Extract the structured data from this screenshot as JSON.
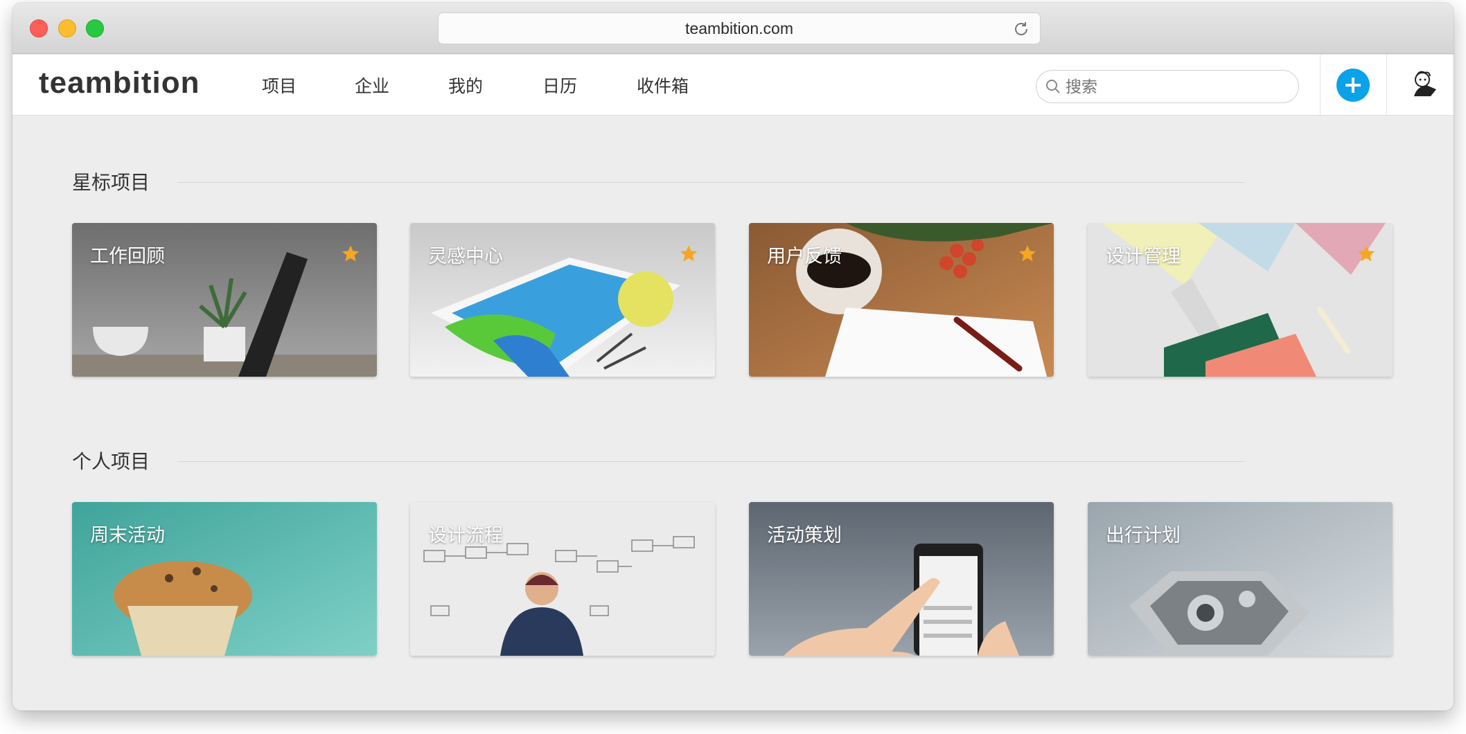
{
  "browser": {
    "url": "teambition.com"
  },
  "header": {
    "logo": "teambition",
    "nav": [
      "项目",
      "企业",
      "我的",
      "日历",
      "收件箱"
    ],
    "search_placeholder": "搜索"
  },
  "sections": {
    "starred": {
      "title": "星标项目",
      "cards": [
        {
          "title": "工作回顾",
          "starred": true
        },
        {
          "title": "灵感中心",
          "starred": true
        },
        {
          "title": "用户反馈",
          "starred": true
        },
        {
          "title": "设计管理",
          "starred": true
        }
      ]
    },
    "personal": {
      "title": "个人项目",
      "cards": [
        {
          "title": "周末活动"
        },
        {
          "title": "设计流程"
        },
        {
          "title": "活动策划"
        },
        {
          "title": "出行计划"
        }
      ]
    }
  },
  "colors": {
    "accent": "#0aa2e8",
    "star": "#f5a623",
    "background": "#ededed"
  }
}
